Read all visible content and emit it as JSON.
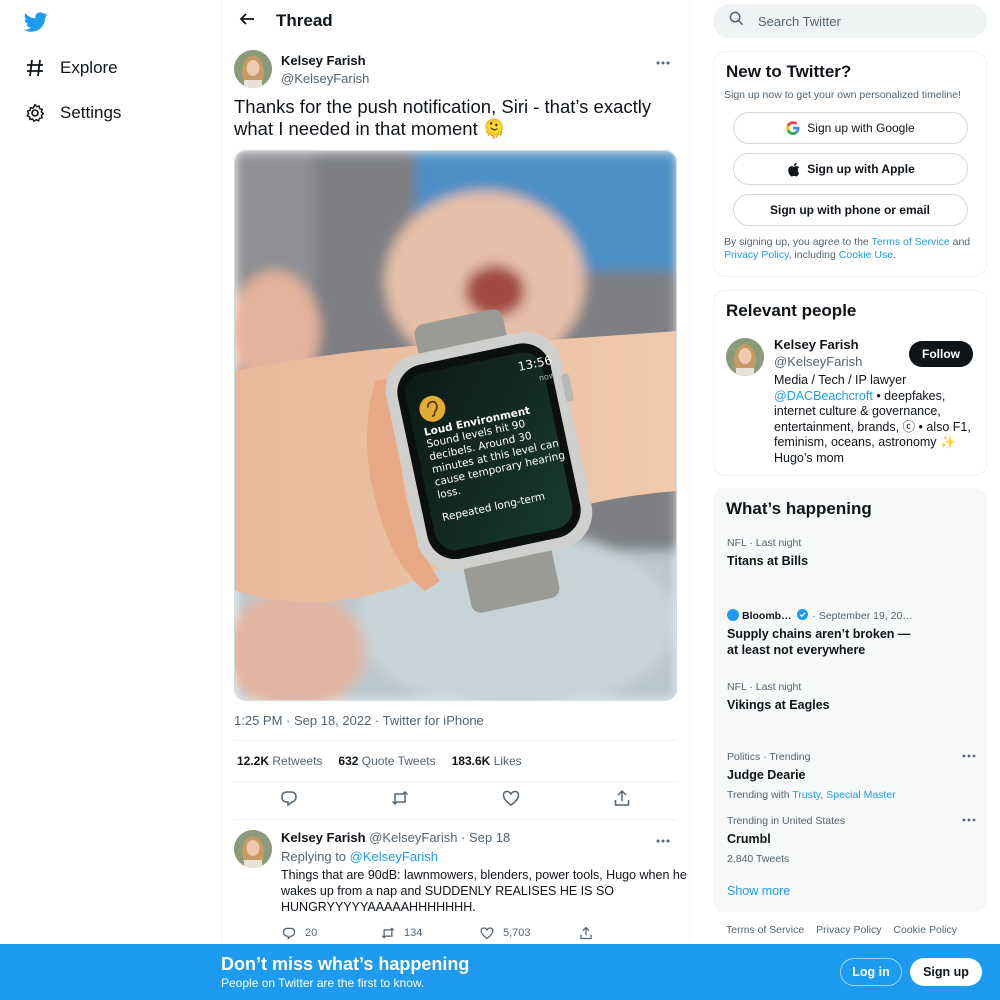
{
  "brand": {
    "accent": "#1d9bf0",
    "text": "#0f1419",
    "muted": "#536471"
  },
  "nav": {
    "logo_icon": "twitter-bird-icon",
    "items": [
      {
        "label": "Explore",
        "icon": "hashtag-icon"
      },
      {
        "label": "Settings",
        "icon": "gear-icon"
      }
    ]
  },
  "header": {
    "title": "Thread",
    "back_icon": "arrow-left-icon"
  },
  "tweet": {
    "author_name": "Kelsey Farish",
    "author_handle": "@KelseyFarish",
    "text": "Thanks for the push notification, Siri - that’s exactly what I needed in that moment 🫠",
    "meta": "1:25 PM · Sep 18, 2022 · Twitter for iPhone",
    "retweets_count": "12.2K",
    "retweets_label": "Retweets",
    "quotes_count": "632",
    "quotes_label": "Quote Tweets",
    "likes_count": "183.6K",
    "likes_label": "Likes",
    "media": {
      "watch_time": "13:56",
      "watch_now": "now",
      "watch_title": "Loud Environment",
      "watch_body": "Sound levels hit 90 decibels. Around 30 minutes at this level can cause temporary hearing loss.",
      "watch_footer": "Repeated long-term"
    }
  },
  "reply": {
    "author_name": "Kelsey Farish",
    "author_meta": "@KelseyFarish · Sep 18",
    "replying_prefix": "Replying to",
    "replying_handle": "@KelseyFarish",
    "text": "Things that are 90dB: lawnmowers, blenders, power tools, Hugo when he wakes up from a nap and SUDDENLY REALISES HE IS SO HUNGRYYYYYAAAAAHHHHHHH.",
    "replies": "20",
    "retweets": "134",
    "likes": "5,703"
  },
  "search": {
    "placeholder": "Search Twitter"
  },
  "new_to_twitter": {
    "title": "New to Twitter?",
    "subtitle": "Sign up now to get your own personalized timeline!",
    "google_label": "Sign up with Google",
    "apple_label": "Sign up with Apple",
    "phone_label": "Sign up with phone or email",
    "legal_prefix": "By signing up, you agree to the",
    "terms_link": "Terms of Service",
    "and": "and",
    "privacy_link": "Privacy Policy",
    "including": ", including",
    "cookie_link": "Cookie Use",
    "period": "."
  },
  "relevant_people": {
    "title": "Relevant people",
    "name": "Kelsey Farish",
    "handle": "@KelseyFarish",
    "follow_label": "Follow",
    "bio_line1": "Media / Tech / IP lawyer",
    "bio_mention": "@DACBeachcroft",
    "bio_rest": " • deepfakes, internet culture & governance, entertainment, brands, ⓒ • also F1, feminism, oceans, astronomy ✨ Hugo’s mom"
  },
  "whats_happening": {
    "title": "What’s happening",
    "trends": [
      {
        "meta": "NFL · Last night",
        "title": "Titans at Bills"
      },
      {
        "source": "Bloomb…",
        "date": "· September 19, 20…",
        "title": "Supply chains aren’t broken — at least not everywhere"
      },
      {
        "meta": "NFL · Last night",
        "title": "Vikings at Eagles"
      },
      {
        "meta": "Politics · Trending",
        "title": "Judge Dearie",
        "sub_prefix": "Trending with",
        "link1": "Trusty",
        "sep": ",",
        "link2": "Special Master"
      },
      {
        "meta": "Trending in United States",
        "title": "Crumbl",
        "sub": "2,840 Tweets"
      }
    ],
    "show_more": "Show more"
  },
  "footer": {
    "links": [
      "Terms of Service",
      "Privacy Policy",
      "Cookie Policy"
    ]
  },
  "bottom_bar": {
    "title": "Don’t miss what’s happening",
    "subtitle": "People on Twitter are the first to know.",
    "login_label": "Log in",
    "signup_label": "Sign up"
  }
}
